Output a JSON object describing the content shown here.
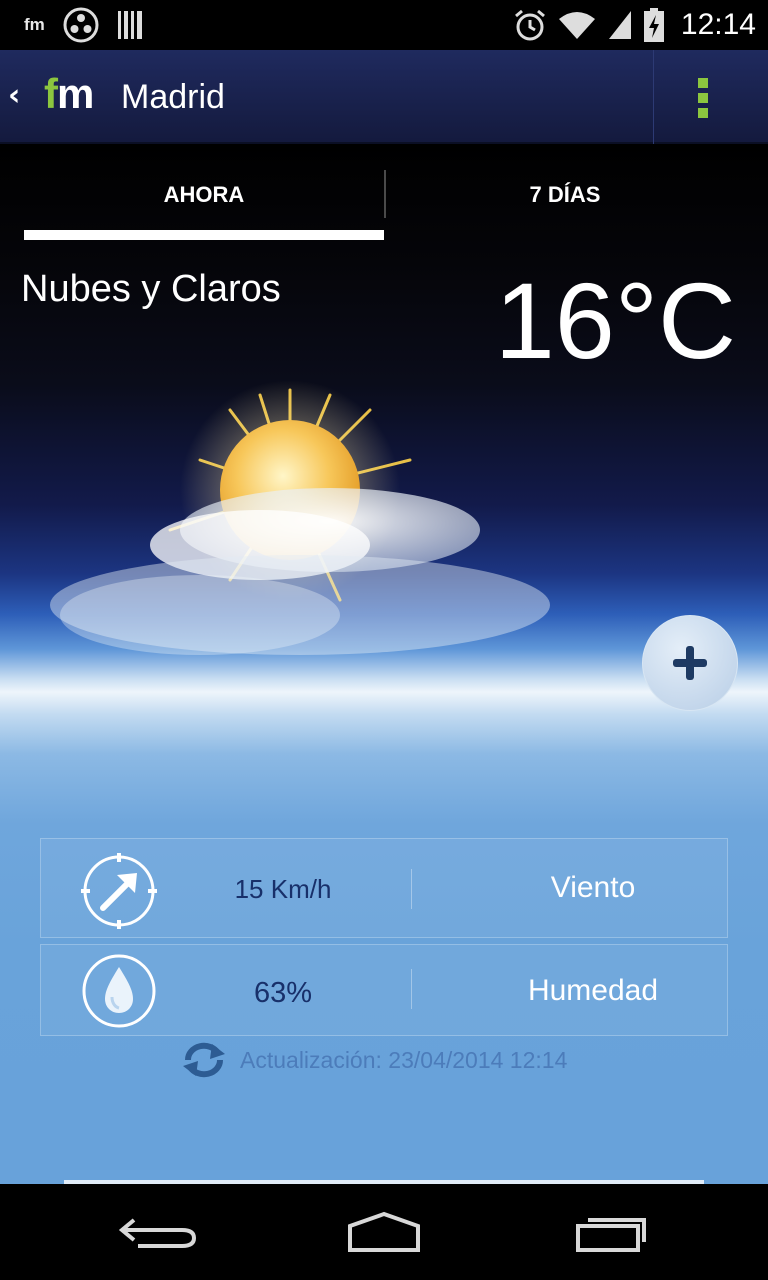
{
  "status_bar": {
    "app_badge": "fm",
    "clock": "12:14",
    "icons": [
      "radio-icon",
      "barcode-icon",
      "alarm-icon",
      "wifi-icon",
      "signal-icon",
      "battery-charging-icon"
    ]
  },
  "action_bar": {
    "back_icon": "chevron-left-icon",
    "logo_f": "f",
    "logo_m": "m",
    "title": "Madrid",
    "overflow_icon": "overflow-menu-icon"
  },
  "tabs": {
    "now_label": "AHORA",
    "week_label": "7 DÍAS",
    "active": "AHORA"
  },
  "current": {
    "condition": "Nubes y Claros",
    "temperature": "16°C",
    "weather_icon": "sun-behind-cloud-icon"
  },
  "fab": {
    "icon": "plus-icon"
  },
  "details": {
    "wind": {
      "value": "15 Km/h",
      "label": "Viento",
      "icon": "wind-direction-icon"
    },
    "humidity": {
      "value": "63%",
      "label": "Humedad",
      "icon": "water-drop-icon"
    }
  },
  "update": {
    "text": "Actualización: 23/04/2014 12:14",
    "icon": "refresh-icon"
  },
  "nav_bar": {
    "back_icon": "nav-back-icon",
    "home_icon": "nav-home-icon",
    "recent_icon": "nav-recent-apps-icon"
  },
  "colors": {
    "brand_green": "#8cc63f",
    "action_bar": "#1f2a5e",
    "value_text": "#18306a",
    "update_text": "#4c7cba"
  }
}
